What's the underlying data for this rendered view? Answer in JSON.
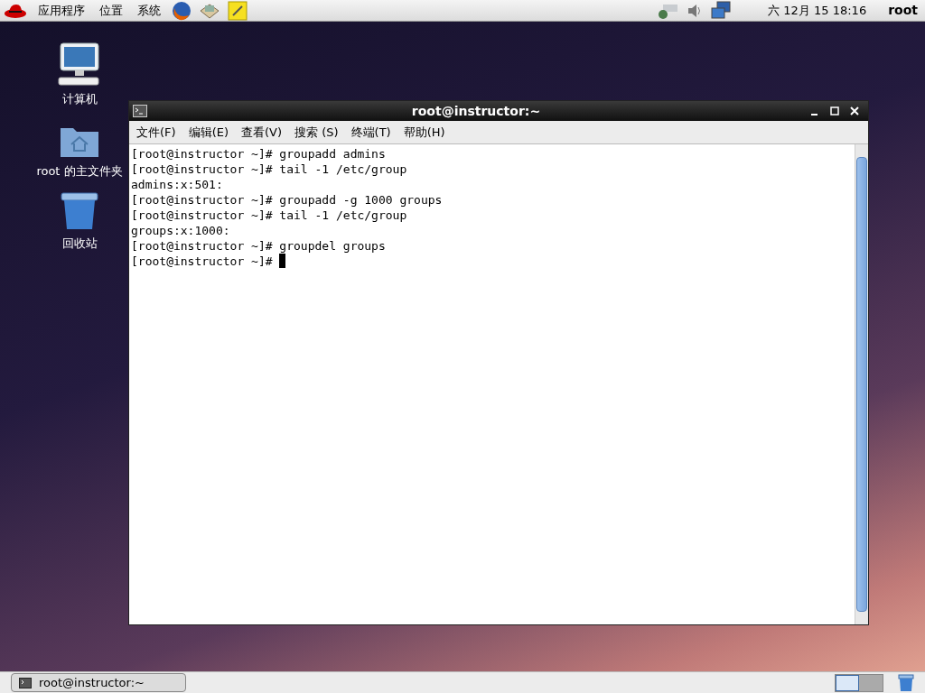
{
  "top_panel": {
    "menus": [
      "应用程序",
      "位置",
      "系统"
    ],
    "clock": "六 12月 15 18:16",
    "user": "root"
  },
  "desktop_icons": [
    {
      "kind": "computer",
      "label": "计算机"
    },
    {
      "kind": "home",
      "label": "root 的主文件夹"
    },
    {
      "kind": "trash",
      "label": "回收站"
    }
  ],
  "terminal": {
    "title": "root@instructor:~",
    "menus": [
      "文件(F)",
      "编辑(E)",
      "查看(V)",
      "搜索 (S)",
      "终端(T)",
      "帮助(H)"
    ],
    "lines": [
      "[root@instructor ~]# groupadd admins",
      "[root@instructor ~]# tail -1 /etc/group",
      "admins:x:501:",
      "[root@instructor ~]# groupadd -g 1000 groups",
      "[root@instructor ~]# tail -1 /etc/group",
      "groups:x:1000:",
      "[root@instructor ~]# groupdel groups",
      "[root@instructor ~]# "
    ]
  },
  "taskbar": {
    "tasks": [
      {
        "label": "root@instructor:~",
        "selected": false
      }
    ],
    "workspaces": [
      {
        "selected": true
      },
      {
        "selected": false
      }
    ]
  }
}
